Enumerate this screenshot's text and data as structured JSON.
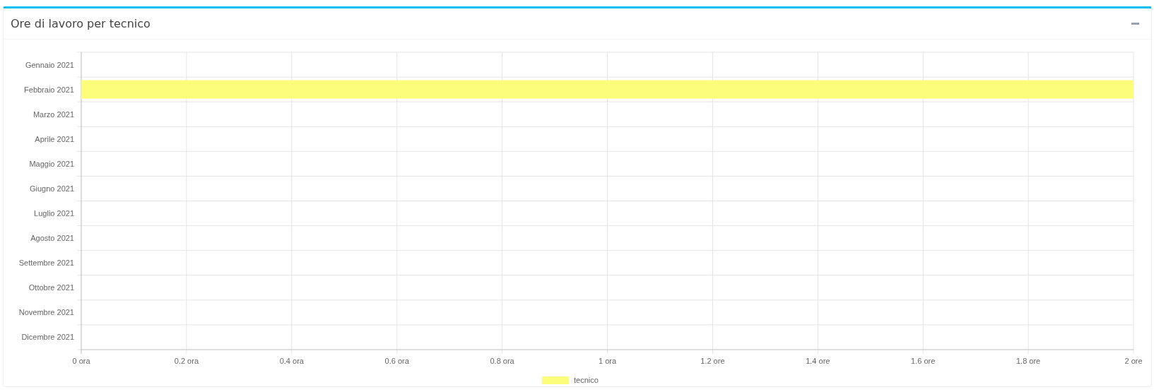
{
  "box": {
    "title": "Ore di lavoro per tecnico",
    "collapse_button": {
      "kind": "minus"
    },
    "chart_data": {
      "type": "bar",
      "orientation": "horizontal",
      "categories": [
        "Gennaio 2021",
        "Febbraio 2021",
        "Marzo 2021",
        "Aprile 2021",
        "Maggio 2021",
        "Giugno 2021",
        "Luglio 2021",
        "Agosto 2021",
        "Settembre 2021",
        "Ottobre 2021",
        "Novembre 2021",
        "Dicembre 2021"
      ],
      "series": [
        {
          "name": "tecnico",
          "color": "#fdfd7c",
          "values": [
            0,
            2,
            0,
            0,
            0,
            0,
            0,
            0,
            0,
            0,
            0,
            0
          ]
        }
      ],
      "xlim": [
        0,
        2
      ],
      "grid": true,
      "xticks": [
        {
          "value": 0,
          "label": "0 ora"
        },
        {
          "value": 0.2,
          "label": "0.2 ora"
        },
        {
          "value": 0.4,
          "label": "0.4 ora"
        },
        {
          "value": 0.6,
          "label": "0.6 ora"
        },
        {
          "value": 0.8,
          "label": "0.8 ora"
        },
        {
          "value": 1,
          "label": "1 ora"
        },
        {
          "value": 1.2,
          "label": "1.2 ore"
        },
        {
          "value": 1.4,
          "label": "1.4 ore"
        },
        {
          "value": 1.6,
          "label": "1.6 ore"
        },
        {
          "value": 1.8,
          "label": "1.8 ore"
        },
        {
          "value": 2,
          "label": "2 ore"
        }
      ]
    }
  }
}
